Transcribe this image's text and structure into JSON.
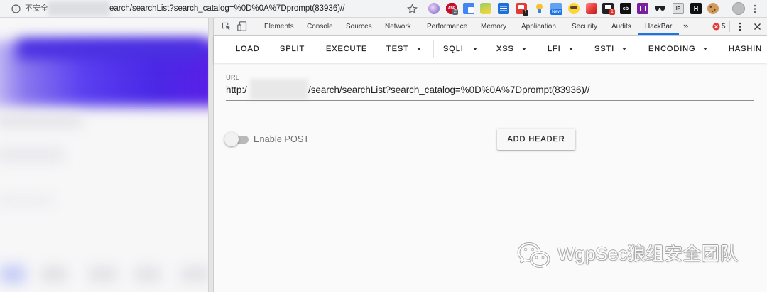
{
  "browser": {
    "address_bar": {
      "info_icon": "info-icon",
      "security_label": "不安全",
      "url_visible": "earch/searchList?search_catalog=%0D%0A%7Dprompt(83936)//",
      "bookmark_icon": "star-icon"
    },
    "extensions": [
      {
        "icon": "purple-extension-icon"
      },
      {
        "icon": "adblock-plus-icon",
        "label": "ABP",
        "badge": "2"
      },
      {
        "icon": "translate-icon"
      },
      {
        "icon": "green-extension-icon"
      },
      {
        "icon": "list-icon"
      },
      {
        "icon": "red-extension-icon",
        "badge": "1"
      },
      {
        "icon": "pin-icon"
      },
      {
        "icon": "blue-extension-icon",
        "badge": "New"
      },
      {
        "icon": "face-icon"
      },
      {
        "icon": "cube-icon"
      },
      {
        "icon": "dark-extension-icon",
        "badge": "1"
      },
      {
        "icon": "cb-extension-icon",
        "label": "cb"
      },
      {
        "icon": "purple-box-extension-icon"
      },
      {
        "icon": "sunglasses-icon"
      },
      {
        "icon": "ip-extension-icon",
        "label": "IP"
      },
      {
        "icon": "h-extension-icon",
        "label": "H"
      },
      {
        "icon": "cookie-icon"
      }
    ],
    "profile_icon": "avatar",
    "menu_icon": "more-vert-icon"
  },
  "devtools": {
    "toolbar_icons": [
      "inspect-element-icon",
      "device-toolbar-icon"
    ],
    "tabs": [
      {
        "label": "Elements"
      },
      {
        "label": "Console"
      },
      {
        "label": "Sources"
      },
      {
        "label": "Network"
      },
      {
        "label": "Performance"
      },
      {
        "label": "Memory"
      },
      {
        "label": "Application"
      },
      {
        "label": "Security"
      },
      {
        "label": "Audits"
      },
      {
        "label": "HackBar",
        "active": true
      }
    ],
    "overflow_label": "»",
    "error_count": "5",
    "accent": "#1a73e8"
  },
  "hackbar": {
    "toolbar": [
      {
        "label": "LOAD",
        "dropdown": false
      },
      {
        "label": "SPLIT",
        "dropdown": false
      },
      {
        "label": "EXECUTE",
        "dropdown": false
      },
      {
        "label": "TEST",
        "dropdown": true
      },
      {
        "label": "SQLI",
        "dropdown": true
      },
      {
        "label": "XSS",
        "dropdown": true
      },
      {
        "label": "LFI",
        "dropdown": true
      },
      {
        "label": "SSTI",
        "dropdown": true
      },
      {
        "label": "ENCODING",
        "dropdown": true
      },
      {
        "label": "HASHIN",
        "dropdown": false
      }
    ],
    "url": {
      "label": "URL",
      "prefix": "http:/",
      "suffix": "/search/searchList?search_catalog=%0D%0A%7Dprompt(83936)//"
    },
    "enable_post": {
      "label": "Enable POST",
      "checked": false
    },
    "add_header_label": "ADD HEADER"
  },
  "watermark": {
    "icon": "wechat-icon",
    "text": "WgpSec狼组安全团队"
  }
}
